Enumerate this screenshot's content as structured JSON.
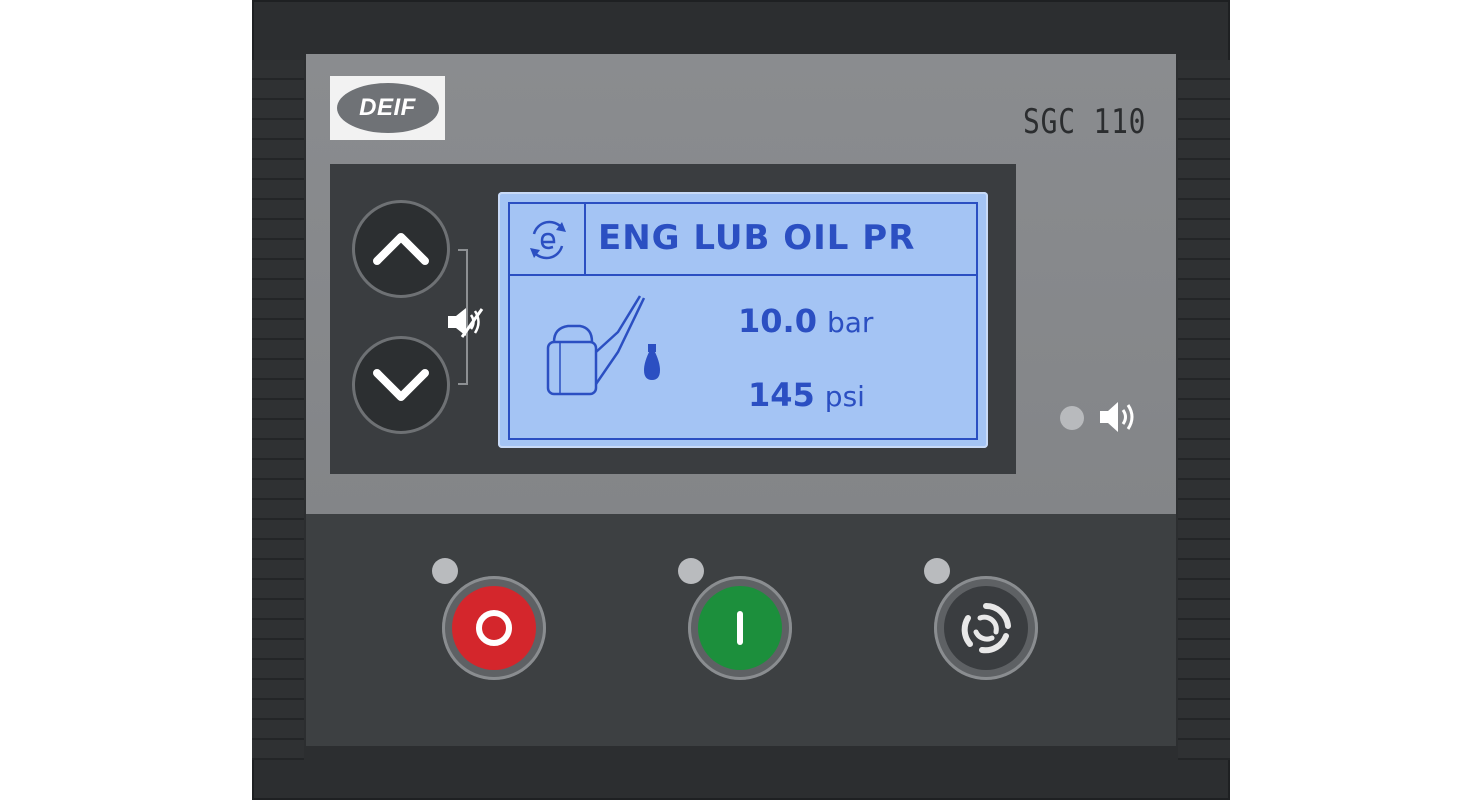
{
  "brand": {
    "logo_text": "DEIF",
    "model": "SGC 110"
  },
  "lcd": {
    "title": "ENG LUB OIL PR",
    "screen_icon": "e-cycle-icon",
    "symbol": "oil-can-icon",
    "readings": [
      {
        "value": "10.0",
        "unit": "bar"
      },
      {
        "value": "145",
        "unit": "psi"
      }
    ]
  },
  "navigation": {
    "up": "chevron-up-icon",
    "down": "chevron-down-icon",
    "combo": "mute-horn-icon"
  },
  "indicators": {
    "horn": "horn-icon"
  },
  "controls": [
    {
      "name": "stop",
      "icon": "stop-icon",
      "color": "#d4262c"
    },
    {
      "name": "start",
      "icon": "start-icon",
      "color": "#1c8f3c"
    },
    {
      "name": "auto",
      "icon": "auto-mode-icon",
      "color": "#3a3d40"
    }
  ],
  "colors": {
    "lcd_background": "#a4c4f4",
    "lcd_text": "#2b4fc2",
    "panel": "#8a8c8f",
    "housing": "#2c2e30"
  }
}
